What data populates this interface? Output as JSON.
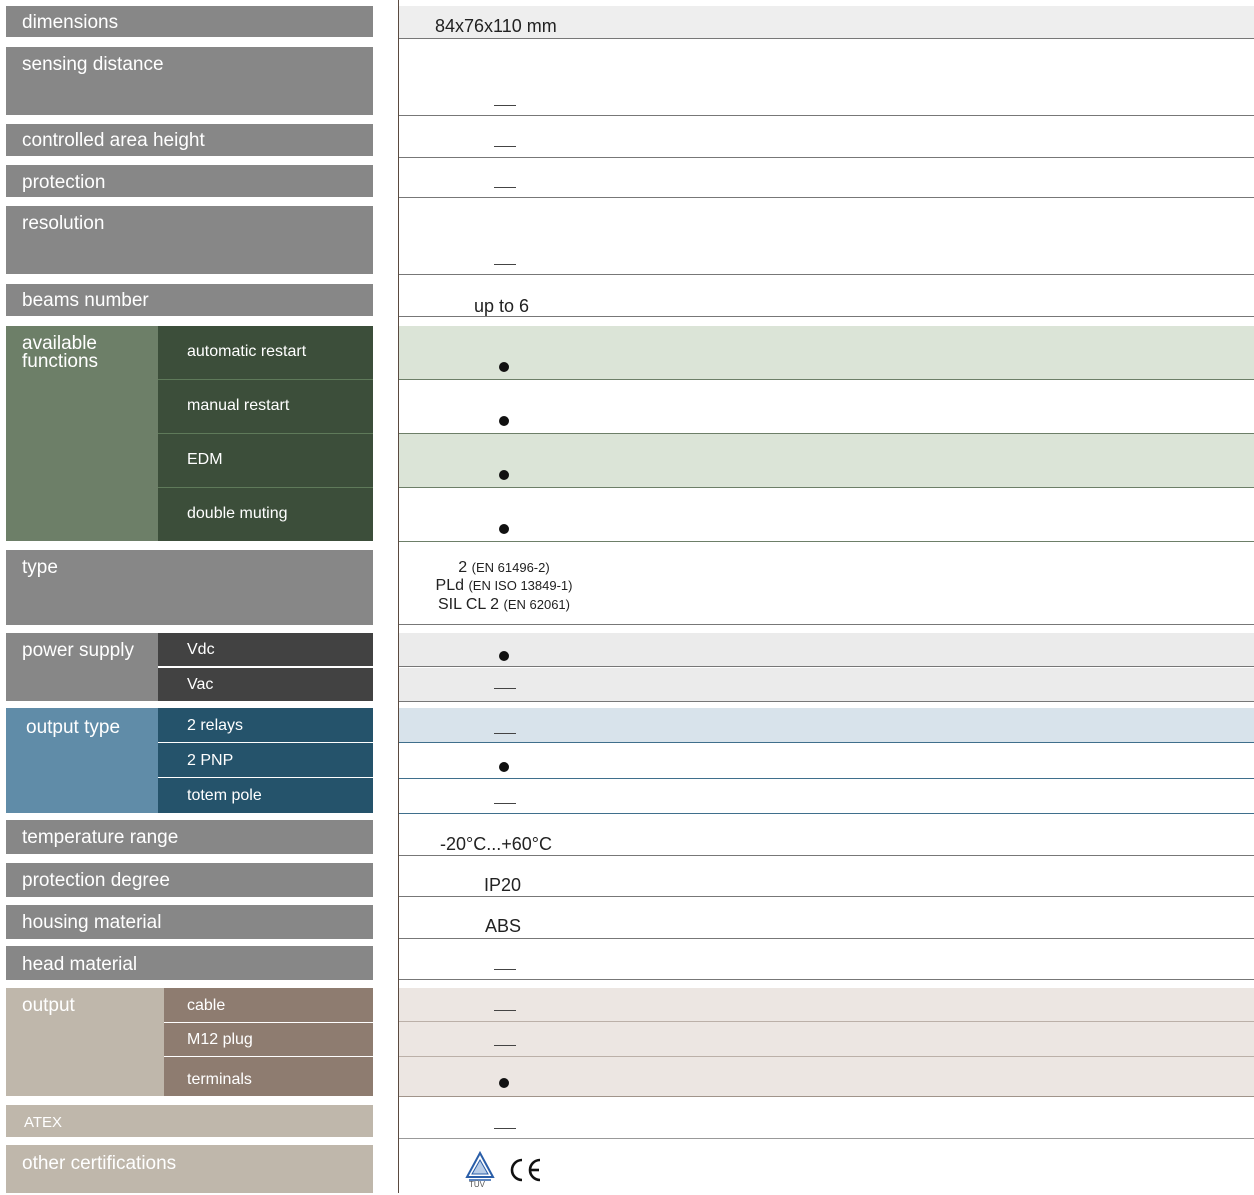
{
  "rows": {
    "dimensions": {
      "label": "dimensions",
      "value": "84x76x110 mm"
    },
    "sensing_distance": {
      "label": "sensing distance",
      "value": "—"
    },
    "controlled_area_height": {
      "label": "controlled area height",
      "value": "—"
    },
    "protection": {
      "label": "protection",
      "value": "—"
    },
    "resolution": {
      "label": "resolution",
      "value": "—"
    },
    "beams_number": {
      "label": "beams number",
      "value": "up to 6"
    },
    "available_functions": {
      "label": "available functions",
      "items": [
        {
          "label": "automatic restart",
          "value": "●"
        },
        {
          "label": "manual restart",
          "value": "●"
        },
        {
          "label": "EDM",
          "value": "●"
        },
        {
          "label": "double muting",
          "value": "●"
        }
      ]
    },
    "type": {
      "label": "type",
      "lines": [
        {
          "main": "2",
          "note": "(EN 61496-2)"
        },
        {
          "main": "PLd",
          "note": "(EN ISO 13849-1)"
        },
        {
          "main": "SIL CL 2",
          "note": "(EN 62061)"
        }
      ]
    },
    "power_supply": {
      "label": "power supply",
      "items": [
        {
          "label": "Vdc",
          "value": "●"
        },
        {
          "label": "Vac",
          "value": "—"
        }
      ]
    },
    "output_type": {
      "label": "output type",
      "items": [
        {
          "label": "2 relays",
          "value": "—"
        },
        {
          "label": "2 PNP",
          "value": "●"
        },
        {
          "label": "totem pole",
          "value": "—"
        }
      ]
    },
    "temperature_range": {
      "label": "temperature range",
      "value": "-20°C...+60°C"
    },
    "protection_degree": {
      "label": "protection degree",
      "value": "IP20"
    },
    "housing_material": {
      "label": "housing material",
      "value": "ABS"
    },
    "head_material": {
      "label": "head material",
      "value": "—"
    },
    "output": {
      "label": "output",
      "items": [
        {
          "label": "cable",
          "value": "—"
        },
        {
          "label": "M12 plug",
          "value": "—"
        },
        {
          "label": "terminals",
          "value": "●"
        }
      ]
    },
    "atex": {
      "label": "ATEX",
      "value": "—"
    },
    "other_certifications": {
      "label": "other certifications",
      "logos": [
        {
          "icon": "tuv-logo-icon",
          "text": "TÜV"
        },
        {
          "icon": "ce-mark-icon",
          "text": "CE"
        }
      ]
    }
  },
  "colors": {
    "label_gray": "#878787",
    "functions_outer": "#6d7f68",
    "functions_inner": "#3c4e3a",
    "functions_band": "#dbe4d7",
    "power_inner": "#424242",
    "power_band": "#ebebeb",
    "output_type_outer": "#608ca8",
    "output_type_inner": "#25536b",
    "output_type_band": "#d8e3eb",
    "output_outer": "#bfb7ab",
    "output_inner": "#8e7c70",
    "output_band": "#ece6e2",
    "top_band": "#eeeeee"
  }
}
